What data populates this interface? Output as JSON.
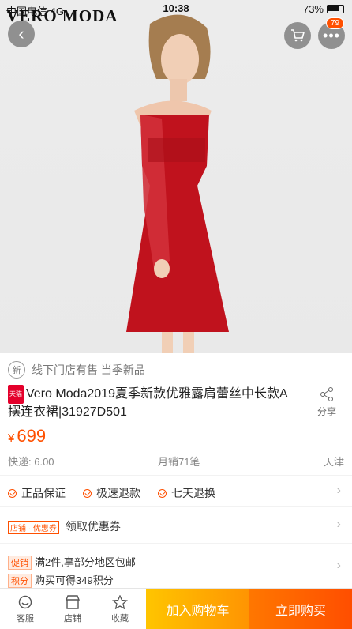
{
  "status": {
    "carrier": "中国电信  4G",
    "time": "10:38",
    "battery": "73%"
  },
  "brand": "VERO MODA",
  "nav": {
    "cart_badge": "79"
  },
  "product": {
    "new_icon": "新",
    "new_label": "线下门店有售 当季新品",
    "tmall_tag": "天猫",
    "title": "Vero Moda2019夏季新款优雅露肩蕾丝中长款A摆连衣裙|31927D501",
    "share": "分享",
    "currency": "¥",
    "price": "699",
    "shipping": "快递: 6.00",
    "sales": "月销71笔",
    "location": "天津"
  },
  "guarantees": [
    "正品保证",
    "极速退款",
    "七天退换"
  ],
  "coupon": {
    "tag": "店铺 · 优惠券",
    "label": "领取优惠券"
  },
  "promo": [
    {
      "tag": "促销",
      "text": "满2件,享部分地区包邮"
    },
    {
      "tag": "积分",
      "text": "购买可得349积分"
    }
  ],
  "bottom": {
    "service": "客服",
    "shop": "店铺",
    "favorite": "收藏",
    "add_to_cart": "加入购物车",
    "buy_now": "立即购买"
  },
  "colors": {
    "accent": "#ff5000",
    "cart_btn": "#ffa500",
    "dress": "#c0121d"
  }
}
